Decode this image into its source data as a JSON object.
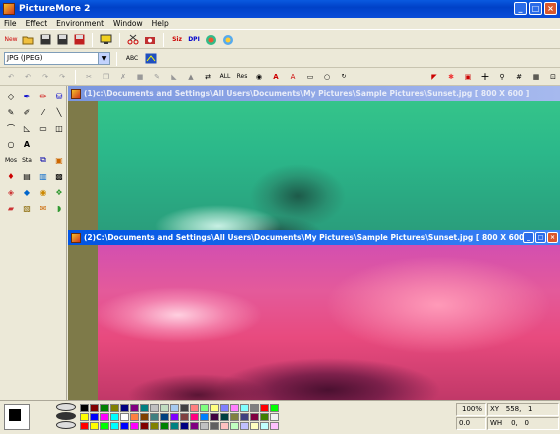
{
  "app": {
    "title": "PictureMore 2"
  },
  "window_controls": {
    "minimize": "_",
    "maximize": "□",
    "close": "×"
  },
  "menu": [
    "File",
    "Effect",
    "Environment",
    "Window",
    "Help"
  ],
  "toolbar1": {
    "new_label": "New"
  },
  "toolbar2": {
    "format_value": "JPG (JPEG)",
    "abc_label": "ABC"
  },
  "toolbar3": {
    "all_label": "ALL",
    "res_label": "Res"
  },
  "left_tools": {
    "mosaic_label": "Mos",
    "stamp_label": "Sta"
  },
  "windows": [
    {
      "title": "(1)c:\\Documents and Settings\\All Users\\Documents\\My Pictures\\Sample Pictures\\Sunset.jpg [ 800 X 600 ]"
    },
    {
      "title": "(2)C:\\Documents and Settings\\All Users\\Documents\\My Pictures\\Sample Pictures\\Sunset.jpg [ 800 X 600 ]"
    }
  ],
  "status": {
    "zoom": "100%",
    "xy": "XY   558,   1",
    "ratio": "0.0",
    "wh": "WH    0,   0"
  },
  "palette": [
    "#000000",
    "#800000",
    "#008000",
    "#808000",
    "#000080",
    "#800080",
    "#008080",
    "#c0c0c0",
    "#c0dcc0",
    "#a6caf0",
    "#404040",
    "#ff8080",
    "#80ff80",
    "#ffff80",
    "#8080ff",
    "#ff80ff",
    "#80ffff",
    "#808080",
    "#ff0000",
    "#00ff00",
    "#ffff00",
    "#0000ff",
    "#ff00ff",
    "#00ffff",
    "#ffffff",
    "#ff8040",
    "#804000",
    "#408080",
    "#004080",
    "#8000ff",
    "#804040",
    "#ff0080",
    "#0080ff",
    "#400040",
    "#004040",
    "#808040",
    "#404080",
    "#800040",
    "#408000",
    "#f0f0f0",
    "#ff0000",
    "#ffff00",
    "#00ff00",
    "#00ffff",
    "#0000ff",
    "#ff00ff",
    "#800000",
    "#808000",
    "#008000",
    "#008080",
    "#000080",
    "#800080",
    "#c0c0c0",
    "#606060",
    "#ffc0c0",
    "#c0ffc0",
    "#c0c0ff",
    "#ffffc0",
    "#c0ffff",
    "#ffc0ff"
  ]
}
